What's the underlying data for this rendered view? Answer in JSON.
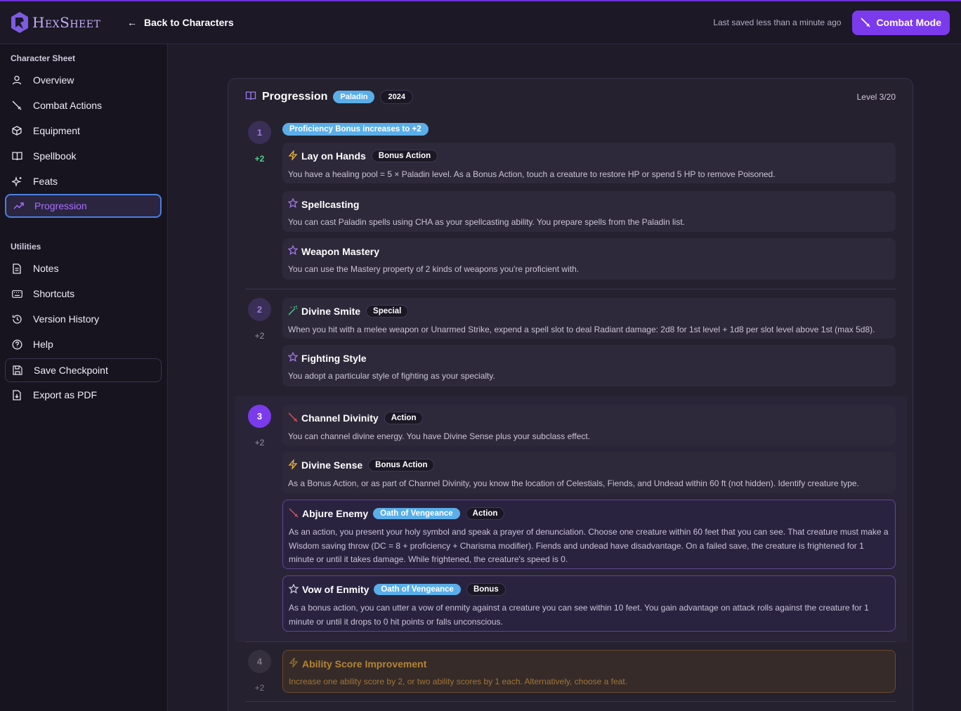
{
  "header": {
    "logo_text": "HexSheet",
    "back_label": "Back to Characters",
    "saved_text": "Last saved less than a minute ago",
    "combat_label": "Combat Mode"
  },
  "sidebar": {
    "section1": "Character Sheet",
    "items1": [
      {
        "label": "Overview",
        "icon": "user-icon"
      },
      {
        "label": "Combat Actions",
        "icon": "sword-icon"
      },
      {
        "label": "Equipment",
        "icon": "box-icon"
      },
      {
        "label": "Spellbook",
        "icon": "book-icon"
      },
      {
        "label": "Feats",
        "icon": "sparkles-icon"
      },
      {
        "label": "Progression",
        "icon": "trending-up-icon"
      }
    ],
    "section2": "Utilities",
    "items2": [
      {
        "label": "Notes",
        "icon": "file-text-icon"
      },
      {
        "label": "Shortcuts",
        "icon": "keyboard-icon"
      },
      {
        "label": "Version History",
        "icon": "history-icon"
      },
      {
        "label": "Help",
        "icon": "help-circle-icon"
      },
      {
        "label": "Save Checkpoint",
        "icon": "save-icon"
      },
      {
        "label": "Export as PDF",
        "icon": "file-download-icon"
      }
    ]
  },
  "panel": {
    "title": "Progression",
    "class_badge": "Paladin",
    "edition_badge": "2024",
    "level_text": "Level 3/20",
    "banner": "Proficiency Bonus increases to +2"
  },
  "levels": [
    {
      "num": "1",
      "bonus": "+2"
    },
    {
      "num": "2",
      "bonus": "+2"
    },
    {
      "num": "3",
      "bonus": "+2"
    },
    {
      "num": "4",
      "bonus": "+2"
    }
  ],
  "features": {
    "lay_on_hands": {
      "title": "Lay on Hands",
      "tag": "Bonus Action",
      "desc": "You have a healing pool = 5 × Paladin level. As a Bonus Action, touch a creature to restore HP or spend 5 HP to remove Poisoned."
    },
    "spellcasting": {
      "title": "Spellcasting",
      "desc": "You can cast Paladin spells using CHA as your spellcasting ability. You prepare spells from the Paladin list."
    },
    "weapon_mastery": {
      "title": "Weapon Mastery",
      "desc": "You can use the Mastery property of 2 kinds of weapons you're proficient with."
    },
    "divine_smite": {
      "title": "Divine Smite",
      "tag": "Special",
      "desc": "When you hit with a melee weapon or Unarmed Strike, expend a spell slot to deal Radiant damage: 2d8 for 1st level + 1d8 per slot level above 1st (max 5d8)."
    },
    "fighting_style": {
      "title": "Fighting Style",
      "desc": "You adopt a particular style of fighting as your specialty."
    },
    "channel_divinity": {
      "title": "Channel Divinity",
      "tag": "Action",
      "desc": "You can channel divine energy. You have Divine Sense plus your subclass effect."
    },
    "divine_sense": {
      "title": "Divine Sense",
      "tag": "Bonus Action",
      "desc": "As a Bonus Action, or as part of Channel Divinity, you know the location of Celestials, Fiends, and Undead within 60 ft (not hidden). Identify creature type."
    },
    "abjure_enemy": {
      "title": "Abjure Enemy",
      "subclass": "Oath of Vengeance",
      "tag": "Action",
      "desc": "As an action, you present your holy symbol and speak a prayer of denunciation. Choose one creature within 60 feet that you can see. That creature must make a Wisdom saving throw (DC = 8 + proficiency + Charisma modifier). Fiends and undead have disadvantage. On a failed save, the creature is frightened for 1 minute or until it takes damage. While frightened, the creature's speed is 0."
    },
    "vow_of_enmity": {
      "title": "Vow of Enmity",
      "subclass": "Oath of Vengeance",
      "tag": "Bonus",
      "desc": "As a bonus action, you can utter a vow of enmity against a creature you can see within 10 feet. You gain advantage on attack rolls against the creature for 1 minute or until it drops to 0 hit points or falls unconscious."
    },
    "asi": {
      "title": "Ability Score Improvement",
      "desc": "Increase one ability score by 2, or two ability scores by 1 each. Alternatively, choose a feat."
    }
  },
  "colors": {
    "accent": "#7c3aed",
    "badge_blue": "#5aaee9",
    "active_border": "#4a7fe0"
  }
}
